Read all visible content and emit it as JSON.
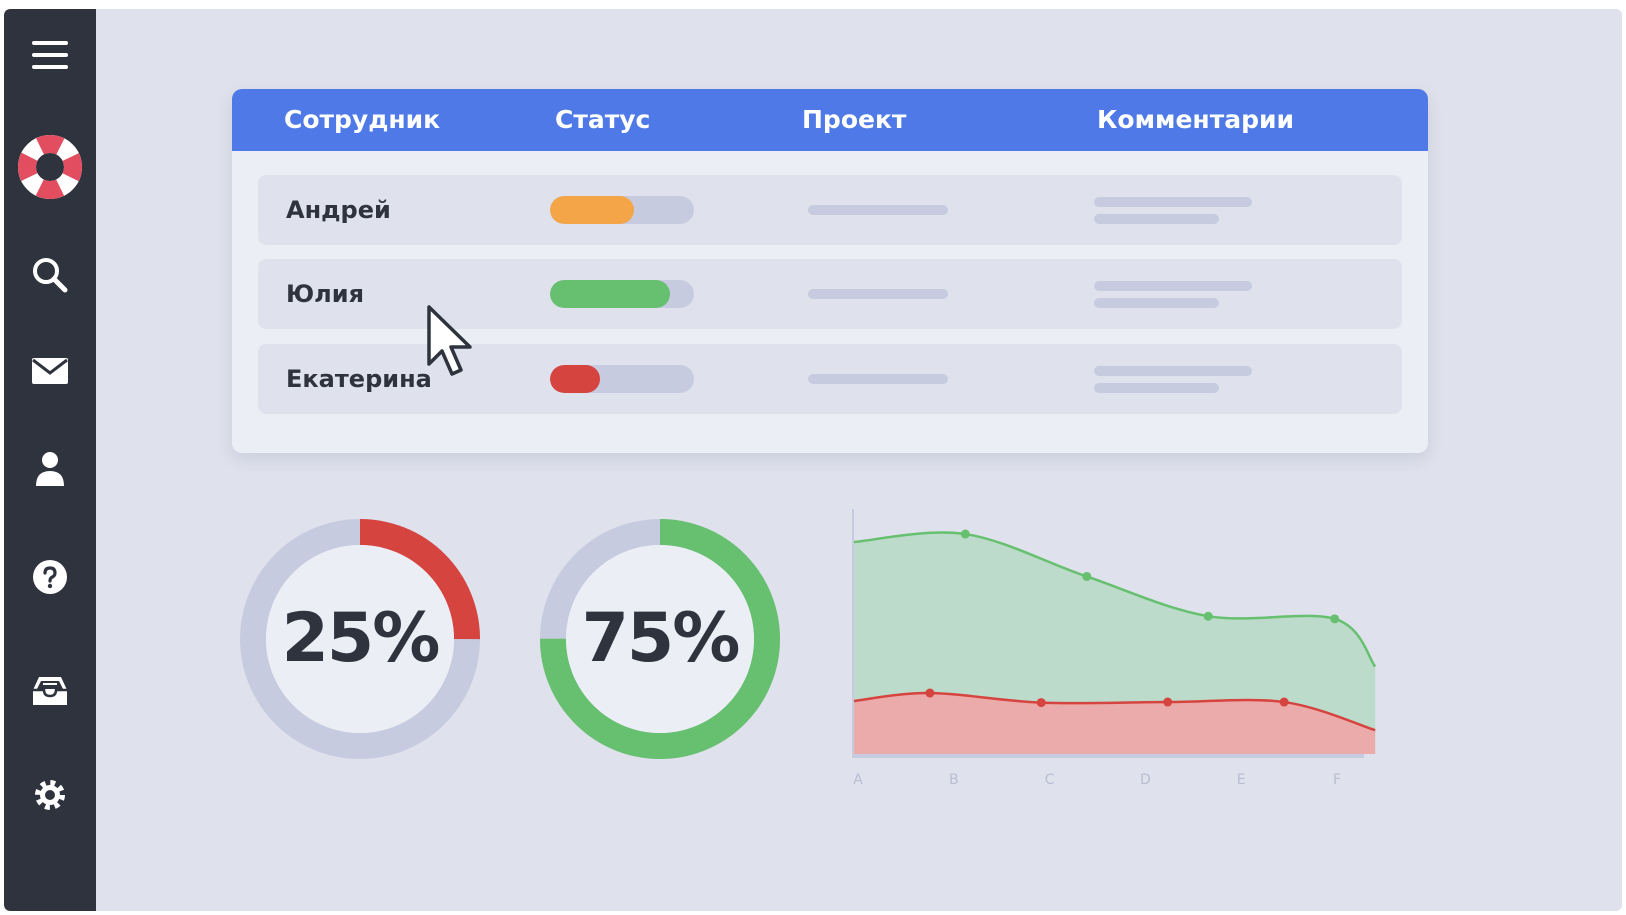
{
  "sidebar": {
    "items": [
      {
        "icon": "menu-icon"
      },
      {
        "icon": "lifebuoy-icon"
      },
      {
        "icon": "search-icon"
      },
      {
        "icon": "mail-icon"
      },
      {
        "icon": "user-icon"
      },
      {
        "icon": "help-icon"
      },
      {
        "icon": "inbox-icon"
      },
      {
        "icon": "gear-icon"
      }
    ]
  },
  "table": {
    "headers": [
      "Сотрудник",
      "Статус",
      "Проект",
      "Комментарии"
    ],
    "rows": [
      {
        "name": "Андрей",
        "status_progress": 0.58,
        "status_color": "#f4a548"
      },
      {
        "name": "Юлия",
        "status_progress": 0.83,
        "status_color": "#66c06f"
      },
      {
        "name": "Екатерина",
        "status_progress": 0.35,
        "status_color": "#d6443f"
      }
    ]
  },
  "donuts": [
    {
      "label": "25%",
      "value": 25,
      "color": "#d6443f"
    },
    {
      "label": "75%",
      "value": 75,
      "color": "#66c06f"
    }
  ],
  "chart_data": {
    "type": "area",
    "x": [
      "A",
      "B",
      "C",
      "D",
      "E",
      "F"
    ],
    "y_ticks": [
      "0",
      "1",
      "2",
      "3",
      "4"
    ],
    "ylim": [
      0,
      4.5
    ],
    "series": [
      {
        "color": "#66c06f",
        "points": [
          [
            0,
            4.0
          ],
          [
            1.1,
            4.15
          ],
          [
            2.3,
            3.35
          ],
          [
            3.5,
            2.6
          ],
          [
            4.75,
            2.55
          ],
          [
            5.15,
            1.65
          ]
        ]
      },
      {
        "color": "#d6443f",
        "points": [
          [
            0,
            1.0
          ],
          [
            0.75,
            1.15
          ],
          [
            1.85,
            0.97
          ],
          [
            3.1,
            0.98
          ],
          [
            4.25,
            0.98
          ],
          [
            5.15,
            0.45
          ]
        ]
      }
    ]
  },
  "colors": {
    "accent": "#4e79e6",
    "sidebar": "#2f333e",
    "background": "#dfe1ec",
    "lifebuoy": "#e24d5f"
  }
}
